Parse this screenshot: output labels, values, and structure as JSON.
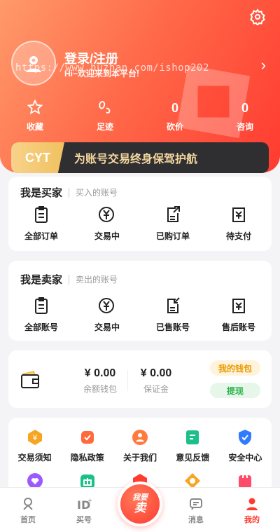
{
  "profile": {
    "login_label": "登录/注册",
    "welcome_text": "Hi~欢迎来到本平台!",
    "watermark": "https://www.huzhan.com/ishop202"
  },
  "stats": [
    {
      "value": "",
      "label": "收藏",
      "icon": "star-icon"
    },
    {
      "value": "",
      "label": "足迹",
      "icon": "footprint-icon"
    },
    {
      "value": "0",
      "label": "砍价",
      "icon": ""
    },
    {
      "value": "0",
      "label": "咨询",
      "icon": ""
    }
  ],
  "banner": {
    "tag": "CYT",
    "text": "为账号交易终身保驾护航"
  },
  "buyer": {
    "title": "我是买家",
    "subtitle": "买入的账号",
    "items": [
      {
        "label": "全部订单",
        "icon": "clipboard-icon"
      },
      {
        "label": "交易中",
        "icon": "yen-exchange-icon"
      },
      {
        "label": "已购订单",
        "icon": "export-doc-icon"
      },
      {
        "label": "待支付",
        "icon": "pay-pending-icon"
      }
    ]
  },
  "seller": {
    "title": "我是卖家",
    "subtitle": "卖出的账号",
    "items": [
      {
        "label": "全部账号",
        "icon": "clipboard-icon"
      },
      {
        "label": "交易中",
        "icon": "yen-exchange-icon"
      },
      {
        "label": "已售账号",
        "icon": "import-doc-icon"
      },
      {
        "label": "售后账号",
        "icon": "after-sale-icon"
      }
    ]
  },
  "wallet": {
    "balance_value": "¥ 0.00",
    "balance_label": "余额钱包",
    "deposit_value": "¥ 0.00",
    "deposit_label": "保证金",
    "my_wallet_label": "我的钱包",
    "withdraw_label": "提现"
  },
  "services": [
    {
      "label": "交易须知",
      "icon": "notice-icon",
      "color": "#f5a623"
    },
    {
      "label": "隐私政策",
      "icon": "privacy-icon",
      "color": "#ff6a3d"
    },
    {
      "label": "关于我们",
      "icon": "about-icon",
      "color": "#ff7a3d"
    },
    {
      "label": "意见反馈",
      "icon": "feedback-icon",
      "color": "#1bbf8a"
    },
    {
      "label": "安全中心",
      "icon": "shield-icon",
      "color": "#2f7bff"
    }
  ],
  "services_row2": [
    {
      "icon": "heart-icon",
      "color": "#9b59ff"
    },
    {
      "icon": "gift-icon",
      "color": "#1bbf8a"
    },
    {
      "icon": "star-badge-icon",
      "color": "#ff3b30"
    },
    {
      "icon": "coin-icon",
      "color": "#f5a623"
    },
    {
      "icon": "bag-icon",
      "color": "#ff4b6a"
    }
  ],
  "tabbar": {
    "tabs": [
      {
        "label": "首页",
        "icon": "home-icon"
      },
      {
        "label": "买号",
        "icon": "id-icon"
      },
      {
        "label": "",
        "icon": ""
      },
      {
        "label": "消息",
        "icon": "message-icon"
      },
      {
        "label": "我的",
        "icon": "user-icon"
      }
    ],
    "sell_line1": "我要",
    "sell_line2": "卖"
  },
  "colors": {
    "accent": "#ff3b30",
    "banner_bg": "#2f2f31",
    "banner_text": "#f4d7a0"
  }
}
